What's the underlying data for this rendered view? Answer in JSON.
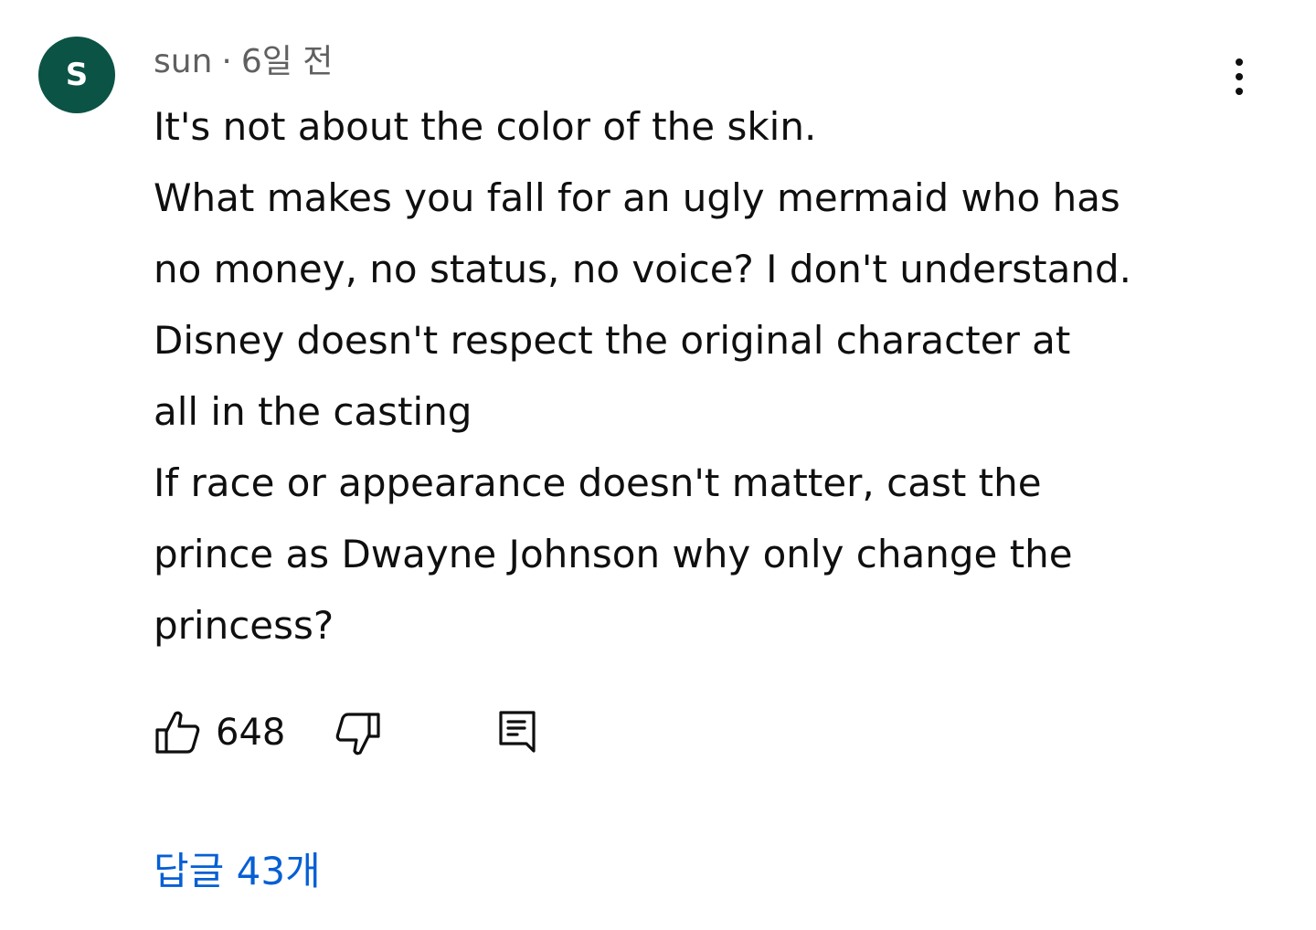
{
  "comment": {
    "avatar_letter": "S",
    "author": "sun",
    "separator": "·",
    "time_ago": "6일 전",
    "lines": [
      "It's not about the color of the skin.",
      "What makes you fall for an ugly mermaid who has",
      "no money, no status, no voice? I don't understand.",
      "Disney doesn't respect the original character at",
      "all in the casting",
      "If race or appearance doesn't matter, cast the",
      "prince as Dwayne Johnson why only change the",
      "princess?"
    ],
    "like_count": "648",
    "replies_label": "답글 43개"
  },
  "icons": {
    "menu": "more-vertical-icon",
    "like": "thumb-up-icon",
    "dislike": "thumb-down-icon",
    "reply": "comment-reply-icon"
  },
  "colors": {
    "avatar_bg": "#0b5345",
    "link": "#065fd4",
    "meta_text": "#606060"
  }
}
